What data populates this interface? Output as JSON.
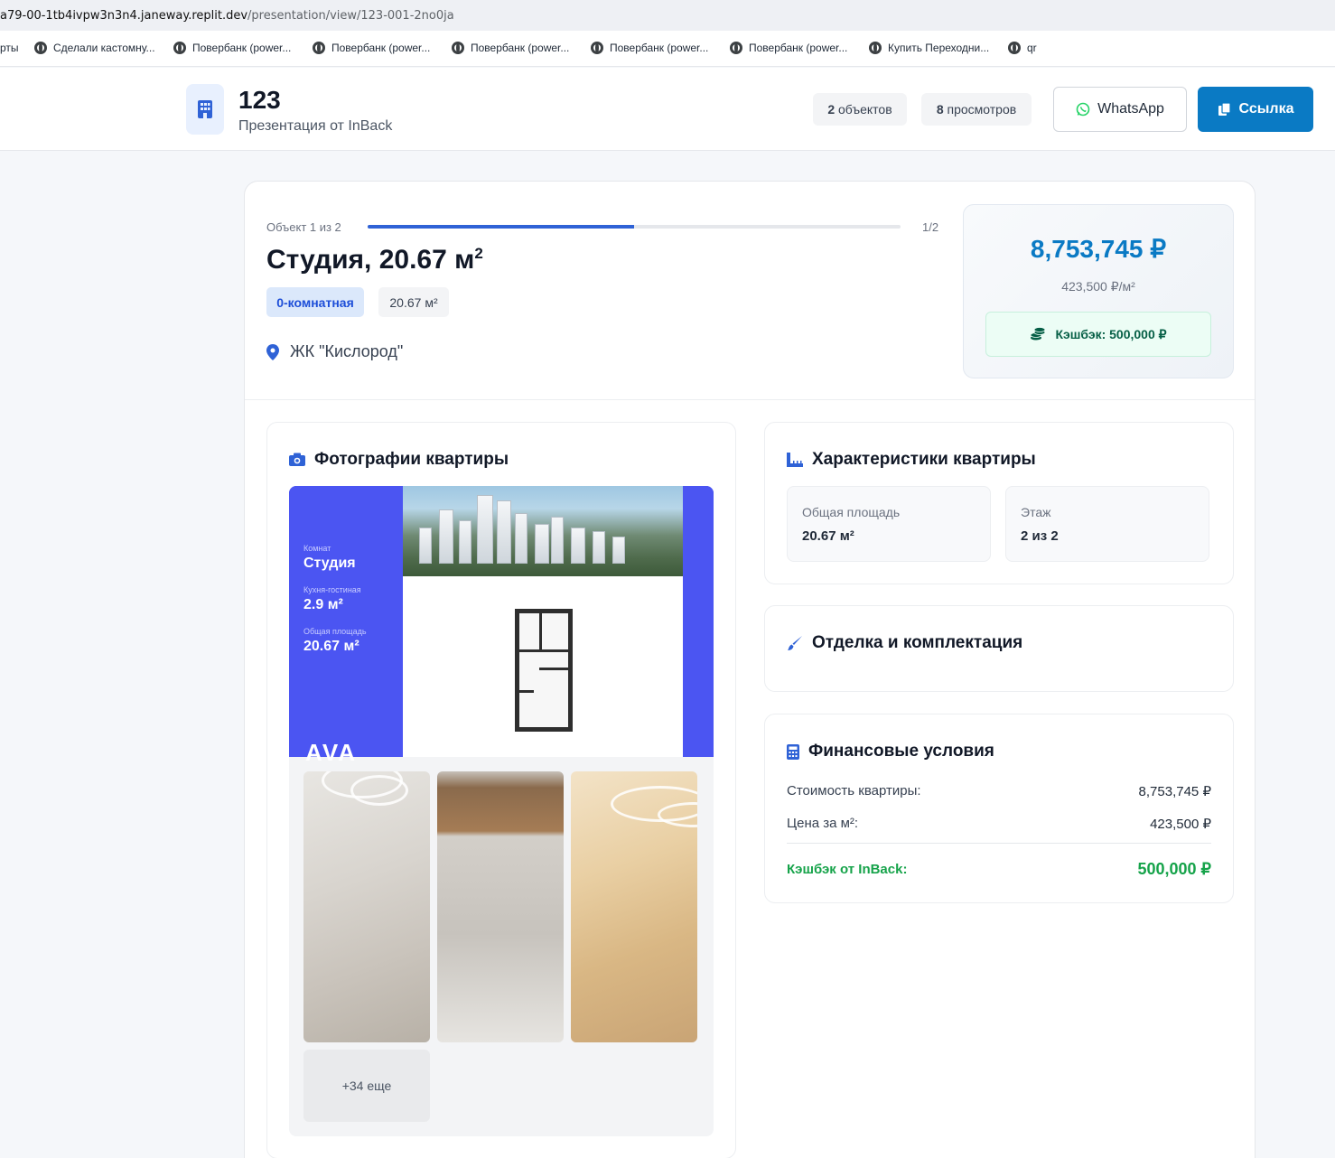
{
  "browser": {
    "url_host": "a79-00-1tb4ivpw3n3n4.janeway.replit.dev",
    "url_path": "/presentation/view/123-001-2no0ja",
    "bookmarks": [
      {
        "label": "рты",
        "icon": "none"
      },
      {
        "label": "Сделали кастомну...",
        "icon": "globe-icon"
      },
      {
        "label": "Повербанк (power...",
        "icon": "globe-icon"
      },
      {
        "label": "Повербанк (power...",
        "icon": "globe-icon"
      },
      {
        "label": "Повербанк (power...",
        "icon": "globe-icon"
      },
      {
        "label": "Повербанк (power...",
        "icon": "globe-icon"
      },
      {
        "label": "Повербанк (power...",
        "icon": "globe-icon"
      },
      {
        "label": "Купить Переходни...",
        "icon": "globe-icon"
      },
      {
        "label": "qr",
        "icon": "globe-icon"
      }
    ]
  },
  "header": {
    "title": "123",
    "subtitle": "Презентация от InBack",
    "objects_count": "2",
    "objects_label": "объектов",
    "views_count": "8",
    "views_label": "просмотров",
    "whatsapp_label": "WhatsApp",
    "link_label": "Ссылка",
    "accent": "#0a7ac4"
  },
  "object": {
    "counter": "Объект 1 из 2",
    "progress_fraction": 0.5,
    "progress_text": "1/2",
    "title": "Студия, 20.67 м",
    "title_sup": "2",
    "rooms_tag": "0-комнатная",
    "area_tag": "20.67 м²",
    "address": "ЖК \"Кислород\""
  },
  "price": {
    "total": "8,753,745 ₽",
    "per_m2": "423,500 ₽/м²",
    "cashback": "Кэшбэк: 500,000 ₽"
  },
  "photos": {
    "title": "Фотографии квартиры",
    "hero": {
      "rooms_label": "Комнат",
      "rooms_value": "Студия",
      "kitchen_label": "Кухня-гостиная",
      "kitchen_value": "2.9 м²",
      "area_label": "Общая площадь",
      "area_value": "20.67 м²",
      "brand": "AVA"
    },
    "more_label": "+34 еще"
  },
  "characteristics": {
    "title": "Характеристики квартиры",
    "items": [
      {
        "label": "Общая площадь",
        "value": "20.67 м²"
      },
      {
        "label": "Этаж",
        "value": "2 из 2"
      }
    ]
  },
  "finish": {
    "title": "Отделка и комплектация"
  },
  "finance": {
    "title": "Финансовые условия",
    "rows": [
      {
        "label": "Стоимость квартиры:",
        "value": "8,753,745 ₽"
      },
      {
        "label": "Цена за м²:",
        "value": "423,500 ₽"
      }
    ],
    "cashback_label": "Кэшбэк от InBack:",
    "cashback_value": "500,000 ₽",
    "cashback_color": "#16a34a"
  }
}
